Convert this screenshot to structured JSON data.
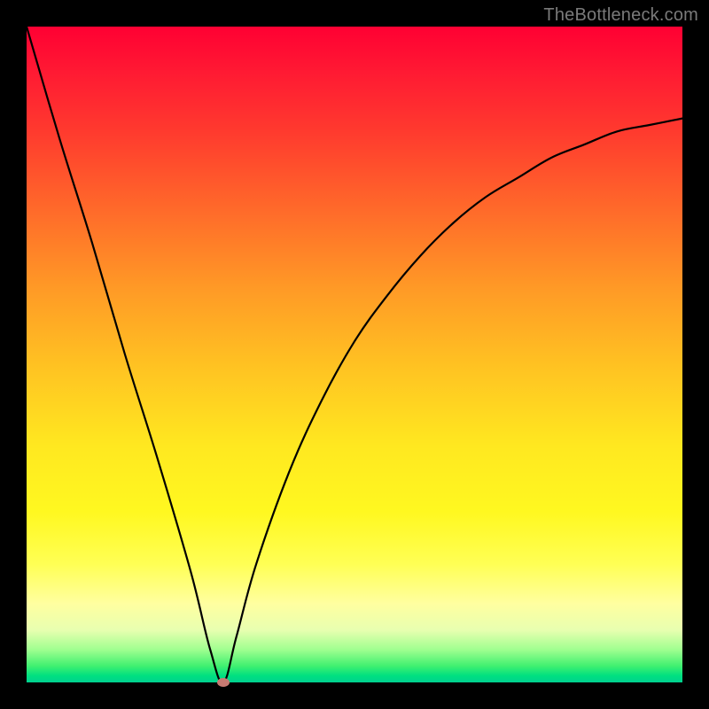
{
  "watermark": "TheBottleneck.com",
  "chart_data": {
    "type": "line",
    "title": "",
    "xlabel": "",
    "ylabel": "",
    "xlim": [
      0,
      100
    ],
    "ylim": [
      0,
      100
    ],
    "minimum_marker": {
      "x": 30,
      "y": 0
    },
    "series": [
      {
        "name": "bottleneck-curve",
        "x": [
          0,
          5,
          10,
          15,
          20,
          25,
          28,
          30,
          32,
          35,
          40,
          45,
          50,
          55,
          60,
          65,
          70,
          75,
          80,
          85,
          90,
          95,
          100
        ],
        "y": [
          100,
          83,
          67,
          50,
          34,
          17,
          5,
          0,
          7,
          18,
          32,
          43,
          52,
          59,
          65,
          70,
          74,
          77,
          80,
          82,
          84,
          85,
          86
        ]
      }
    ],
    "background_gradient": {
      "top": "#ff0033",
      "mid": "#ffe820",
      "bottom": "#00d090"
    }
  }
}
